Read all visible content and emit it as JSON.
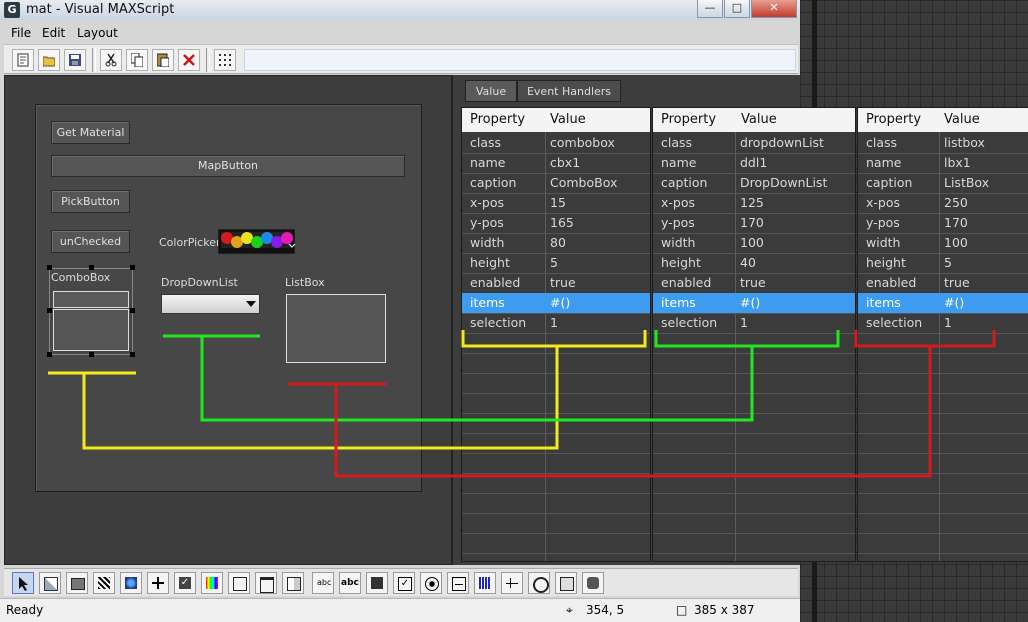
{
  "window": {
    "title": "mat - Visual MAXScript",
    "icon": "G"
  },
  "menubar": [
    "File",
    "Edit",
    "Layout"
  ],
  "toolbar": [
    "new-icon",
    "open-icon",
    "save-icon",
    "cut-icon",
    "copy-icon",
    "paste-icon",
    "delete-icon",
    "grid-icon"
  ],
  "form": {
    "get_material": "Get Material",
    "map_button": "MapButton",
    "pick_button": "PickButton",
    "unchecked": "unChecked",
    "colorpicker_label": "ColorPicker",
    "combobox_label": "ComboBox",
    "dropdown_label": "DropDownList",
    "listbox_label": "ListBox"
  },
  "tabs": [
    "Value",
    "Event Handlers"
  ],
  "headers": {
    "property": "Property",
    "value": "Value"
  },
  "tables": [
    {
      "rows": [
        [
          "class",
          "combobox"
        ],
        [
          "name",
          "cbx1"
        ],
        [
          "caption",
          "ComboBox"
        ],
        [
          "x-pos",
          "15"
        ],
        [
          "y-pos",
          "165"
        ],
        [
          "width",
          "80"
        ],
        [
          "height",
          "5"
        ],
        [
          "enabled",
          "true"
        ],
        [
          "items",
          "#()"
        ],
        [
          "selection",
          "1"
        ]
      ]
    },
    {
      "rows": [
        [
          "class",
          "dropdownList"
        ],
        [
          "name",
          "ddl1"
        ],
        [
          "caption",
          "DropDownList"
        ],
        [
          "x-pos",
          "125"
        ],
        [
          "y-pos",
          "170"
        ],
        [
          "width",
          "100"
        ],
        [
          "height",
          "40"
        ],
        [
          "enabled",
          "true"
        ],
        [
          "items",
          "#()"
        ],
        [
          "selection",
          "1"
        ]
      ]
    },
    {
      "rows": [
        [
          "class",
          "listbox"
        ],
        [
          "name",
          "lbx1"
        ],
        [
          "caption",
          "ListBox"
        ],
        [
          "x-pos",
          "250"
        ],
        [
          "y-pos",
          "170"
        ],
        [
          "width",
          "100"
        ],
        [
          "height",
          "5"
        ],
        [
          "enabled",
          "true"
        ],
        [
          "items",
          "#()"
        ],
        [
          "selection",
          "1"
        ]
      ]
    }
  ],
  "selected_row": "items",
  "status": {
    "text": "Ready",
    "position": "354, 5",
    "size": "385 x 387"
  },
  "colors": {
    "yellow": "#f2ea1c",
    "green": "#22e622",
    "red": "#d21c1c",
    "selection": "#3d9bf0"
  }
}
